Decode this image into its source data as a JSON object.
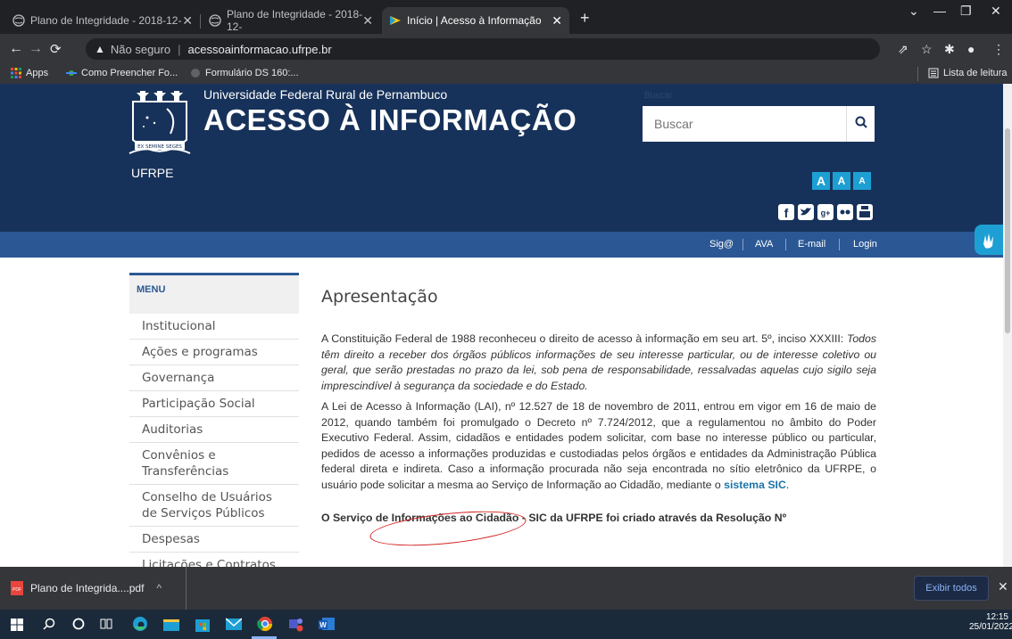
{
  "browser": {
    "tabs": [
      {
        "label": "Plano de Integridade - 2018-12-",
        "active": false
      },
      {
        "label": "Plano de Integridade - 2018-12-",
        "active": false
      },
      {
        "label": "Início | Acesso à Informação",
        "active": true
      }
    ],
    "new_tab_glyph": "+",
    "address": {
      "security_label": "Não seguro",
      "url": "acessoainformacao.ufrpe.br"
    },
    "bookmarks": [
      {
        "label": "Apps",
        "icon": "apps-grid-icon"
      },
      {
        "label": "Como Preencher Fo...",
        "icon": "bookmark-favicon"
      },
      {
        "label": "Formulário DS 160:...",
        "icon": "bookmark-favicon"
      }
    ],
    "reading_list_label": "Lista de leitura"
  },
  "header": {
    "university": "Universidade Federal Rural de Pernambuco",
    "title": "ACESSO À INFORMAÇÃO",
    "logo_text": "UFRPE",
    "logo_motto": "EX SEMINE SEGES",
    "search_label": "Buscar",
    "search_placeholder": "Buscar",
    "font_buttons": [
      "A",
      "A",
      "A"
    ],
    "social_icons": [
      "facebook-icon",
      "twitter-icon",
      "googleplus-icon",
      "flickr-icon",
      "youtube-icon"
    ]
  },
  "topnav": {
    "items": [
      "Sig@",
      "AVA",
      "E-mail",
      "Login"
    ]
  },
  "sidebar": {
    "heading": "MENU",
    "items": [
      "Institucional",
      "Ações e programas",
      "Governança",
      "Participação Social",
      "Auditorias",
      "Convênios e Transferências",
      "Conselho de Usuários de Serviços Públicos",
      "Despesas",
      "Licitações e Contratos"
    ]
  },
  "content": {
    "title": "Apresentação",
    "p1_start": "A Constituição Federal de 1988 reconheceu o direito de acesso à informação em seu art. 5º, inciso XXXIII: ",
    "p1_quote": "Todos têm direito a receber dos órgãos públicos informações de seu interesse particular, ou de interesse coletivo ou geral, que serão prestadas no prazo da lei, sob pena de responsabilidade, ressalvadas aquelas cujo sigilo seja imprescindível à segurança da sociedade e do Estado.",
    "p2": "A Lei de Acesso à Informação (LAI), nº 12.527 de 18 de novembro de 2011, entrou em vigor em 16 de maio de 2012, quando também foi promulgado o Decreto nº 7.724/2012, que a regulamentou no âmbito do Poder Executivo Federal. Assim, cidadãos e entidades podem solicitar, com base no interesse público ou particular, pedidos de acesso a informações produzidas e custodiadas pelos órgãos e entidades da Administração Pública federal direta e indireta. Caso a informação procurada não seja encontrada no sítio eletrônico da UFRPE, o usuário pode solicitar a mesma ao Serviço de Informação ao Cidadão, mediante o ",
    "p2_link": "sistema SIC",
    "p2_end": ".",
    "p3_partial": "O Serviço de Informações ao Cidadão - SIC da UFRPE foi criado através da Resolução Nº"
  },
  "downloads": {
    "file": "Plano de Integrida....pdf",
    "show_all": "Exibir todos"
  },
  "taskbar": {
    "time": "12:15",
    "date": "25/01/2022"
  },
  "colors": {
    "header_bg": "#17325a",
    "menubar_bg": "#2b5894",
    "accent": "#1e9fd3",
    "annotation": "#d42222"
  }
}
